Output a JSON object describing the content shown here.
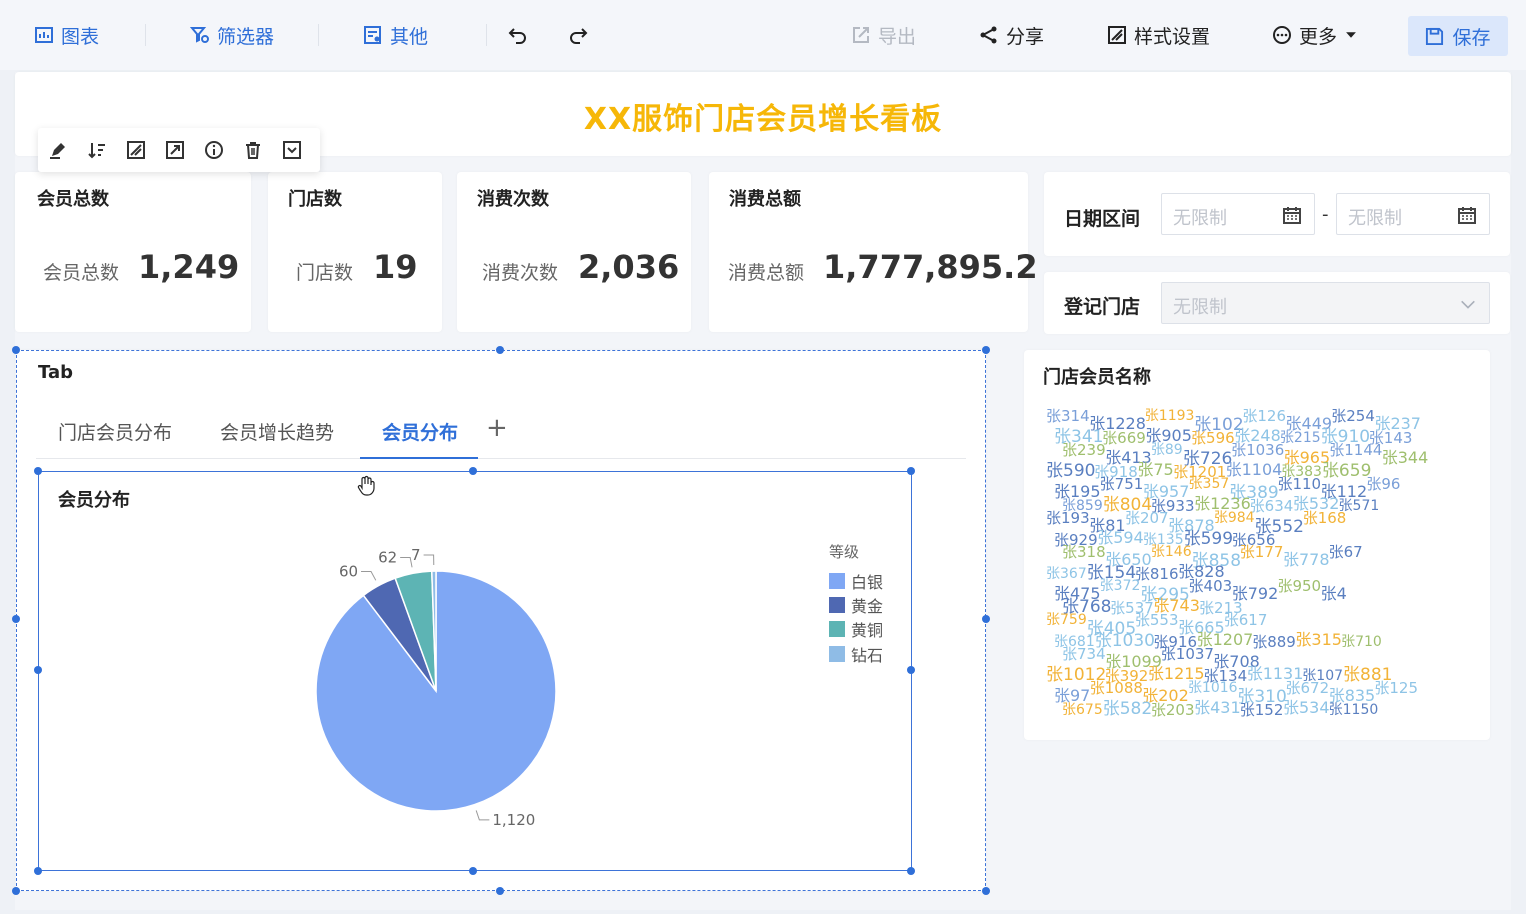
{
  "toolbar": {
    "chart": "图表",
    "filter": "筛选器",
    "other": "其他",
    "export": "导出",
    "share": "分享",
    "style": "样式设置",
    "more": "更多",
    "save": "保存"
  },
  "dashboard": {
    "title": "XX服饰门店会员增长看板"
  },
  "kpis": [
    {
      "title": "会员总数",
      "label": "会员总数",
      "value": "1,249"
    },
    {
      "title": "门店数",
      "label": "门店数",
      "value": "19"
    },
    {
      "title": "消费次数",
      "label": "消费次数",
      "value": "2,036"
    },
    {
      "title": "消费总额",
      "label": "消费总额",
      "value": "1,777,895.2"
    }
  ],
  "filters": {
    "date_label": "日期区间",
    "date_start_placeholder": "无限制",
    "date_sep": "-",
    "date_end_placeholder": "无限制",
    "store_label": "登记门店",
    "store_placeholder": "无限制"
  },
  "tab_widget": {
    "label": "Tab",
    "tabs": [
      "门店会员分布",
      "会员增长趋势",
      "会员分布"
    ],
    "active_index": 2,
    "add": "+"
  },
  "pie_chart": {
    "title": "会员分布",
    "legend_title": "等级",
    "colors": [
      "#7fa7f4",
      "#4f68b2",
      "#5db4b4",
      "#8fbce6"
    ]
  },
  "chart_data": {
    "type": "pie",
    "title": "会员分布",
    "legend_title": "等级",
    "categories": [
      "白银",
      "黄金",
      "黄铜",
      "钻石"
    ],
    "values": [
      1120,
      60,
      62,
      7
    ],
    "data_labels": [
      "1,120",
      "60",
      "62",
      "7"
    ]
  },
  "wordcloud": {
    "title": "门店会员名称",
    "colors": {
      "blue": "#7a9fd8",
      "orange": "#f2b338",
      "green": "#9fbf6e",
      "light": "#8ec4e6",
      "steel": "#5a7fc0"
    },
    "words": [
      {
        "t": "张314",
        "c": "blue"
      },
      {
        "t": "张1228",
        "c": "steel"
      },
      {
        "t": "张1193",
        "c": "orange"
      },
      {
        "t": "张102",
        "c": "blue"
      },
      {
        "t": "张126",
        "c": "light"
      },
      {
        "t": "张449",
        "c": "blue"
      },
      {
        "t": "张254",
        "c": "steel"
      },
      {
        "t": "张237",
        "c": "light"
      },
      {
        "t": "张341",
        "c": "light"
      },
      {
        "t": "张669",
        "c": "green"
      },
      {
        "t": "张905",
        "c": "steel"
      },
      {
        "t": "张596",
        "c": "orange"
      },
      {
        "t": "张248",
        "c": "light"
      },
      {
        "t": "张215",
        "c": "blue"
      },
      {
        "t": "张910",
        "c": "light"
      },
      {
        "t": "张143",
        "c": "blue"
      },
      {
        "t": "张239",
        "c": "green"
      },
      {
        "t": "张413",
        "c": "steel"
      },
      {
        "t": "张89",
        "c": "light"
      },
      {
        "t": "张726",
        "c": "steel"
      },
      {
        "t": "张1036",
        "c": "blue"
      },
      {
        "t": "张965",
        "c": "orange"
      },
      {
        "t": "张1144",
        "c": "blue"
      },
      {
        "t": "张344",
        "c": "green"
      },
      {
        "t": "张590",
        "c": "steel"
      },
      {
        "t": "张918",
        "c": "light"
      },
      {
        "t": "张75",
        "c": "green"
      },
      {
        "t": "张1201",
        "c": "orange"
      },
      {
        "t": "张1104",
        "c": "blue"
      },
      {
        "t": "张383",
        "c": "green"
      },
      {
        "t": "张659",
        "c": "green"
      },
      {
        "t": "张195",
        "c": "steel"
      },
      {
        "t": "张751",
        "c": "steel"
      },
      {
        "t": "张957",
        "c": "light"
      },
      {
        "t": "张357",
        "c": "orange"
      },
      {
        "t": "张389",
        "c": "light"
      },
      {
        "t": "张110",
        "c": "steel"
      },
      {
        "t": "张112",
        "c": "steel"
      },
      {
        "t": "张96",
        "c": "blue"
      },
      {
        "t": "张859",
        "c": "blue"
      },
      {
        "t": "张804",
        "c": "orange"
      },
      {
        "t": "张933",
        "c": "steel"
      },
      {
        "t": "张1236",
        "c": "green"
      },
      {
        "t": "张634",
        "c": "light"
      },
      {
        "t": "张532",
        "c": "light"
      },
      {
        "t": "张571",
        "c": "steel"
      },
      {
        "t": "张193",
        "c": "steel"
      },
      {
        "t": "张81",
        "c": "steel"
      },
      {
        "t": "张207",
        "c": "light"
      },
      {
        "t": "张878",
        "c": "light"
      },
      {
        "t": "张984",
        "c": "orange"
      },
      {
        "t": "张552",
        "c": "steel"
      },
      {
        "t": "张168",
        "c": "orange"
      },
      {
        "t": "张929",
        "c": "steel"
      },
      {
        "t": "张594",
        "c": "light"
      },
      {
        "t": "张135",
        "c": "light"
      },
      {
        "t": "张599",
        "c": "steel"
      },
      {
        "t": "张656",
        "c": "steel"
      },
      {
        "t": "张318",
        "c": "green"
      },
      {
        "t": "张650",
        "c": "light"
      },
      {
        "t": "张146",
        "c": "orange"
      },
      {
        "t": "张858",
        "c": "light"
      },
      {
        "t": "张177",
        "c": "orange"
      },
      {
        "t": "张778",
        "c": "light"
      },
      {
        "t": "张67",
        "c": "steel"
      },
      {
        "t": "张367",
        "c": "light"
      },
      {
        "t": "张154",
        "c": "steel"
      },
      {
        "t": "张816",
        "c": "steel"
      },
      {
        "t": "张828",
        "c": "steel"
      },
      {
        "t": "张475",
        "c": "steel"
      },
      {
        "t": "张372",
        "c": "light"
      },
      {
        "t": "张295",
        "c": "light"
      },
      {
        "t": "张403",
        "c": "steel"
      },
      {
        "t": "张792",
        "c": "steel"
      },
      {
        "t": "张950",
        "c": "green"
      },
      {
        "t": "张4",
        "c": "steel"
      },
      {
        "t": "张768",
        "c": "steel"
      },
      {
        "t": "张537",
        "c": "light"
      },
      {
        "t": "张743",
        "c": "orange"
      },
      {
        "t": "张213",
        "c": "light"
      },
      {
        "t": "张759",
        "c": "orange"
      },
      {
        "t": "张405",
        "c": "light"
      },
      {
        "t": "张553",
        "c": "light"
      },
      {
        "t": "张665",
        "c": "light"
      },
      {
        "t": "张617",
        "c": "light"
      },
      {
        "t": "张681",
        "c": "light"
      },
      {
        "t": "张1030",
        "c": "light"
      },
      {
        "t": "张916",
        "c": "steel"
      },
      {
        "t": "张1207",
        "c": "green"
      },
      {
        "t": "张889",
        "c": "steel"
      },
      {
        "t": "张315",
        "c": "orange"
      },
      {
        "t": "张710",
        "c": "green"
      },
      {
        "t": "张734",
        "c": "light"
      },
      {
        "t": "张1099",
        "c": "green"
      },
      {
        "t": "张1037",
        "c": "steel"
      },
      {
        "t": "张708",
        "c": "steel"
      },
      {
        "t": "张1012",
        "c": "orange"
      },
      {
        "t": "张392",
        "c": "orange"
      },
      {
        "t": "张1215",
        "c": "orange"
      },
      {
        "t": "张134",
        "c": "steel"
      },
      {
        "t": "张1131",
        "c": "light"
      },
      {
        "t": "张107",
        "c": "steel"
      },
      {
        "t": "张881",
        "c": "orange"
      },
      {
        "t": "张97",
        "c": "blue"
      },
      {
        "t": "张1088",
        "c": "orange"
      },
      {
        "t": "张202",
        "c": "orange"
      },
      {
        "t": "张1016",
        "c": "light"
      },
      {
        "t": "张310",
        "c": "light"
      },
      {
        "t": "张672",
        "c": "light"
      },
      {
        "t": "张835",
        "c": "light"
      },
      {
        "t": "张125",
        "c": "light"
      },
      {
        "t": "张675",
        "c": "orange"
      },
      {
        "t": "张582",
        "c": "light"
      },
      {
        "t": "张203",
        "c": "green"
      },
      {
        "t": "张431",
        "c": "light"
      },
      {
        "t": "张152",
        "c": "steel"
      },
      {
        "t": "张534",
        "c": "light"
      },
      {
        "t": "张1150",
        "c": "steel"
      }
    ]
  }
}
